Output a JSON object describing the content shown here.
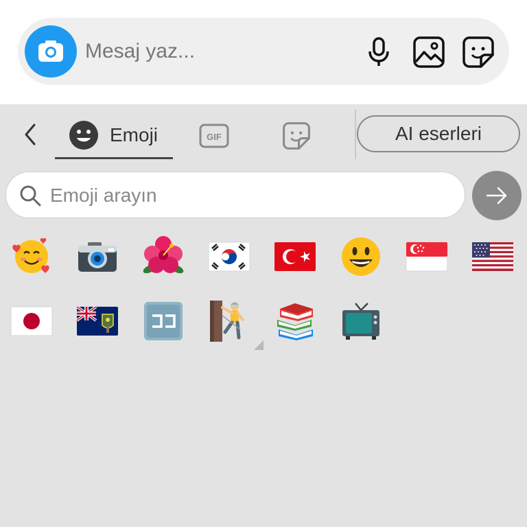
{
  "composer": {
    "placeholder": "Mesaj yaz..."
  },
  "tabs": {
    "emoji_label": "Emoji",
    "gif_label": "GIF"
  },
  "ai_button_label": "AI eserleri",
  "search": {
    "placeholder": "Emoji arayın"
  },
  "emojis": [
    {
      "name": "smiling-face-with-hearts"
    },
    {
      "name": "camera"
    },
    {
      "name": "hibiscus"
    },
    {
      "name": "flag-south-korea"
    },
    {
      "name": "flag-turkey"
    },
    {
      "name": "grinning-face"
    },
    {
      "name": "flag-singapore"
    },
    {
      "name": "flag-united-states"
    },
    {
      "name": "flag-japan"
    },
    {
      "name": "flag-south-georgia"
    },
    {
      "name": "koko-button"
    },
    {
      "name": "person-climbing"
    },
    {
      "name": "books"
    },
    {
      "name": "television"
    }
  ],
  "colors": {
    "accent_blue": "#1e9bf0",
    "panel_bg": "#e3e3e3",
    "go_button": "#8a8a8a"
  }
}
